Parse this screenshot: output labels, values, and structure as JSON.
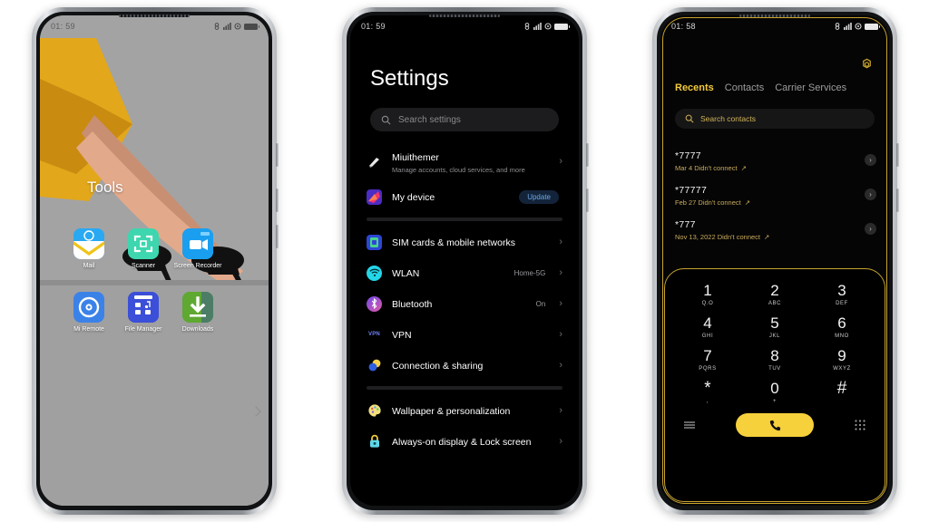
{
  "phones": [
    {
      "id": "home-screen",
      "status": {
        "time": "01: 59",
        "icons": [
          "alarm-icon",
          "signal-icon",
          "settings-icon",
          "battery-icon"
        ]
      },
      "wallpaper": {
        "name": "illustration-legs-heels",
        "colors": {
          "background": "#a3a3a3",
          "dress": "#e3a71b",
          "dress_dark": "#c98b10",
          "skin": "#e3a98b",
          "skin_dark": "#c98f73",
          "shoes": "#111111",
          "floor": "#8e8e8e"
        }
      },
      "folder_label": "Tools",
      "apps": [
        {
          "label": "Mail",
          "icon": "mail-icon",
          "color": "#2196f3"
        },
        {
          "label": "Scanner",
          "icon": "scanner-icon",
          "color": "#3ed6ae"
        },
        {
          "label": "Screen Recorder",
          "icon": "screen-recorder-icon",
          "color": "#2196f3"
        },
        {
          "label": "Mi Remote",
          "icon": "mi-remote-icon",
          "color": "#3b82e8"
        },
        {
          "label": "File Manager",
          "icon": "file-manager-icon",
          "color": "#3b4fd8"
        },
        {
          "label": "Downloads",
          "icon": "downloads-icon",
          "color": "#5fa832"
        }
      ]
    },
    {
      "id": "settings-screen",
      "status": {
        "time": "01: 59",
        "icons": [
          "alarm-icon",
          "signal-icon",
          "settings-icon",
          "battery-icon"
        ]
      },
      "title": "Settings",
      "search": {
        "placeholder": "Search settings",
        "icon": "search-icon"
      },
      "rows": [
        {
          "title": "Miuithemer",
          "subtitle": "Manage accounts, cloud services, and more",
          "icon": "account-icon",
          "value": "",
          "badge": "",
          "chevron": "›"
        },
        {
          "title": "My device",
          "subtitle": "",
          "icon": "device-icon",
          "value": "",
          "badge": "Update",
          "chevron": ""
        },
        {
          "divider": true
        },
        {
          "title": "SIM cards & mobile networks",
          "subtitle": "",
          "icon": "sim-icon",
          "value": "",
          "badge": "",
          "chevron": "›"
        },
        {
          "title": "WLAN",
          "subtitle": "",
          "icon": "wifi-icon",
          "value": "Home-5G",
          "badge": "",
          "chevron": "›"
        },
        {
          "title": "Bluetooth",
          "subtitle": "",
          "icon": "bluetooth-icon",
          "value": "On",
          "badge": "",
          "chevron": "›"
        },
        {
          "title": "VPN",
          "subtitle": "",
          "icon": "vpn-icon",
          "value": "",
          "badge": "",
          "chevron": "›"
        },
        {
          "title": "Connection & sharing",
          "subtitle": "",
          "icon": "connection-icon",
          "value": "",
          "badge": "",
          "chevron": "›"
        },
        {
          "divider": true
        },
        {
          "title": "Wallpaper & personalization",
          "subtitle": "",
          "icon": "palette-icon",
          "value": "",
          "badge": "",
          "chevron": "›"
        },
        {
          "title": "Always-on display & Lock screen",
          "subtitle": "",
          "icon": "lock-icon",
          "value": "",
          "badge": "",
          "chevron": "›"
        }
      ]
    },
    {
      "id": "dialer-screen",
      "status": {
        "time": "01: 58",
        "icons": [
          "alarm-icon",
          "signal-icon",
          "settings-icon",
          "battery-icon"
        ]
      },
      "accent_color": "#f4c93b",
      "frame_color": "#c8a42e",
      "settings_icon": "gear-icon",
      "tabs": [
        {
          "label": "Recents",
          "active": true
        },
        {
          "label": "Contacts",
          "active": false
        },
        {
          "label": "Carrier Services",
          "active": false
        }
      ],
      "search": {
        "placeholder": "Search contacts",
        "icon": "search-icon"
      },
      "calls": [
        {
          "number": "*7777",
          "meta": "Mar 4 Didn't connect",
          "arrow": "↗",
          "info": "›"
        },
        {
          "number": "*77777",
          "meta": "Feb 27 Didn't connect",
          "arrow": "↗",
          "info": "›"
        },
        {
          "number": "*777",
          "meta": "Nov 13, 2022 Didn't connect",
          "arrow": "↗",
          "info": "›"
        }
      ],
      "keys": [
        {
          "digit": "1",
          "letters": "Q.O"
        },
        {
          "digit": "2",
          "letters": "ABC"
        },
        {
          "digit": "3",
          "letters": "DEF"
        },
        {
          "digit": "4",
          "letters": "GHI"
        },
        {
          "digit": "5",
          "letters": "JKL"
        },
        {
          "digit": "6",
          "letters": "MNO"
        },
        {
          "digit": "7",
          "letters": "PQRS"
        },
        {
          "digit": "8",
          "letters": "TUV"
        },
        {
          "digit": "9",
          "letters": "WXYZ"
        },
        {
          "digit": "*",
          "letters": ","
        },
        {
          "digit": "0",
          "letters": "+"
        },
        {
          "digit": "#",
          "letters": ""
        }
      ],
      "actions": {
        "menu_icon": "menu-icon",
        "call_icon": "call-icon",
        "keypad_icon": "keypad-icon"
      }
    }
  ]
}
